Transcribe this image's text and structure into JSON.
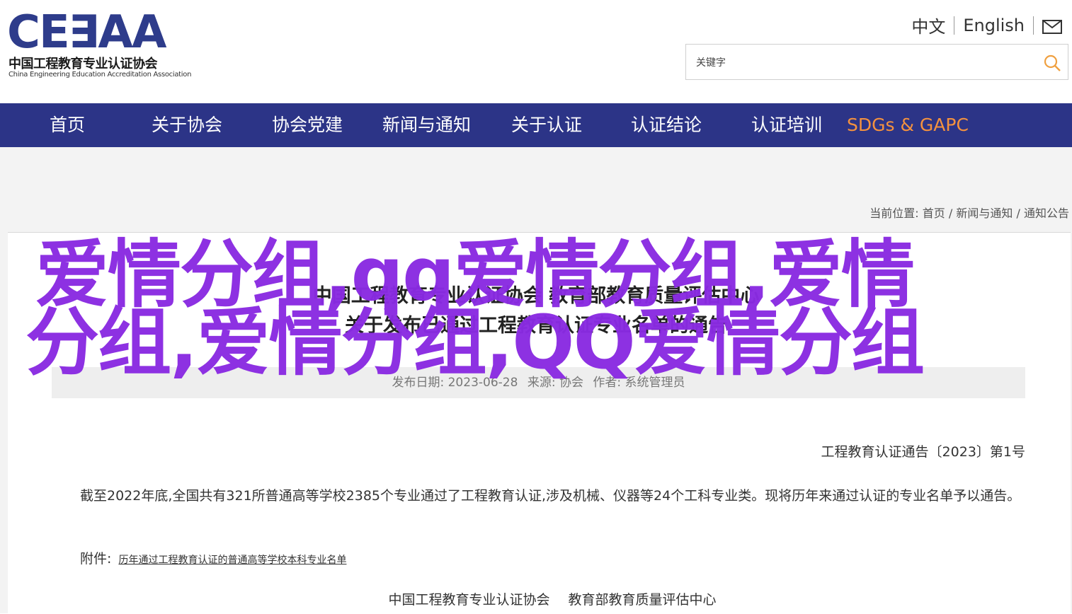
{
  "header": {
    "logo_mark": "CE∃AA",
    "logo_cn": "中国工程教育专业认证协会",
    "logo_en": "China Engineering Education Accreditation Association",
    "lang_cn": "中文",
    "lang_en": "English",
    "search_placeholder": "关键字"
  },
  "nav": {
    "items": [
      {
        "label": "首页"
      },
      {
        "label": "关于协会"
      },
      {
        "label": "协会党建"
      },
      {
        "label": "新闻与通知"
      },
      {
        "label": "关于认证"
      },
      {
        "label": "认证结论"
      },
      {
        "label": "认证培训"
      },
      {
        "label": "SDGs & GAPC"
      }
    ],
    "highlight_color": "#f5923e"
  },
  "breadcrumb": {
    "prefix": "当前位置:",
    "items": [
      "首页",
      "新闻与通知",
      "通知公告"
    ],
    "separator": "/"
  },
  "article": {
    "title_line1": "中国工程教育专业认证协会 教育部教育质量评估中心",
    "title_line2": "关于发布已通过工程教育认证专业名单的通告",
    "meta_date": "发布日期: 2023-06-28",
    "meta_source": "来源: 协会",
    "meta_author": "作者: 系统管理员",
    "doc_number": "工程教育认证通告〔2023〕第1号",
    "paragraph": "截至2022年底,全国共有321所普通高等学校2385个专业通过了工程教育认证,涉及机械、仪器等24个工科专业类。现将历年来通过认证的专业名单予以通告。",
    "attachment_label": "附件:",
    "attachment_link": "历年通过工程教育认证的普通高等学校本科专业名单",
    "signature_1": "中国工程教育专业认证协会",
    "signature_2": "教育部教育质量评估中心"
  },
  "overlay": {
    "text": "爱情分组,qq爱情分组,爱情分组,爱情分组,QQ爱情分组",
    "color": "#8a2be2"
  }
}
